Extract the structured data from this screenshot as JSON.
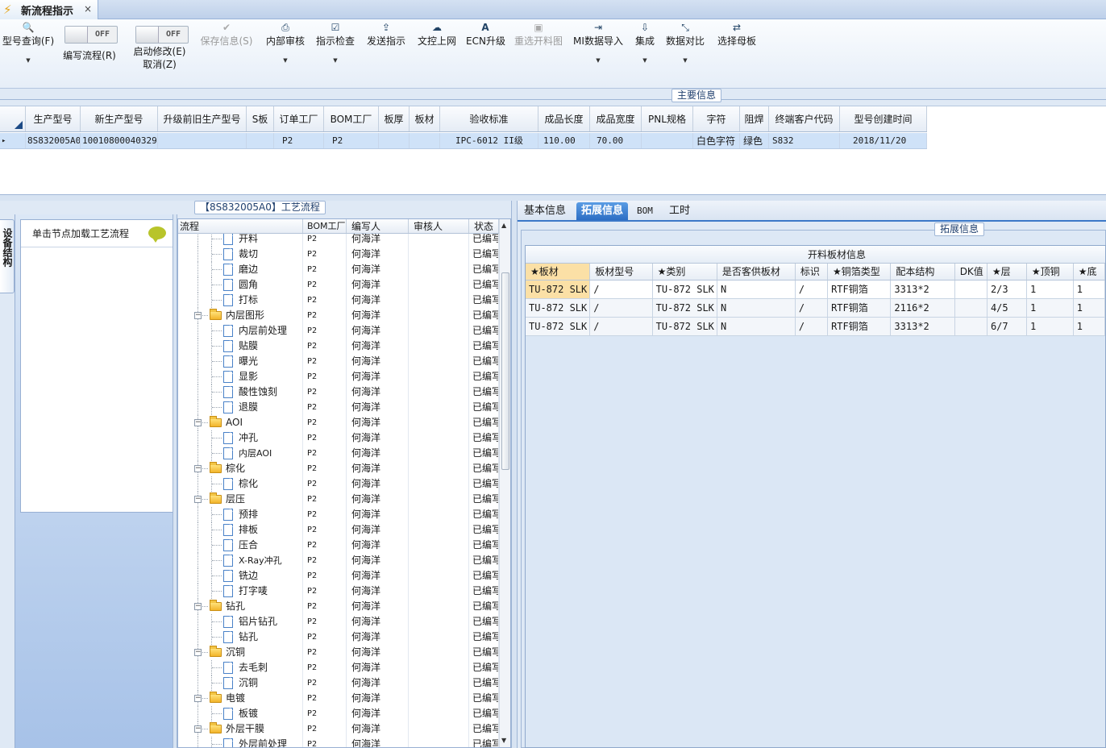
{
  "window": {
    "tab_title": "新流程指示",
    "close_glyph": "×",
    "tab_icon": "lightning-icon"
  },
  "toolbar": {
    "buttons": [
      {
        "label": "型号查询(F)",
        "icon": "search-icon",
        "glyph": "🔍",
        "enabled": true
      },
      {
        "label": "编写流程(R)",
        "toggle": "OFF"
      },
      {
        "label": "启动修改(E)",
        "label2": "取消(Z)",
        "toggle": "OFF"
      },
      {
        "label": "保存信息(S)",
        "icon": "check-icon",
        "glyph": "✔",
        "enabled": false
      },
      {
        "label": "内部审核",
        "icon": "print-icon",
        "glyph": "⎙",
        "enabled": true
      },
      {
        "label": "指示检查",
        "icon": "checkbox-icon",
        "glyph": "☑",
        "enabled": true
      },
      {
        "label": "发送指示",
        "icon": "upload-icon",
        "glyph": "⇪",
        "enabled": true
      },
      {
        "label": "文控上网",
        "icon": "cloud-upload-icon",
        "glyph": "☁",
        "enabled": true
      },
      {
        "label": "ECN升级",
        "icon": "font-a-icon",
        "glyph": "A",
        "enabled": true
      },
      {
        "label": "重选开料图",
        "icon": "image-icon",
        "glyph": "▣",
        "enabled": false
      },
      {
        "label": "MI数据导入",
        "icon": "sign-in-icon",
        "glyph": "⇥",
        "enabled": true
      },
      {
        "label": "集成",
        "icon": "download-icon",
        "glyph": "⇩",
        "enabled": true
      },
      {
        "label": "数据对比",
        "icon": "compress-icon",
        "glyph": "⤡",
        "enabled": true
      },
      {
        "label": "选择母板",
        "icon": "shuffle-icon",
        "glyph": "⇄",
        "enabled": true
      }
    ],
    "dropdown_glyph": "▼"
  },
  "main_info": {
    "caption": "主要信息",
    "columns": [
      "生产型号",
      "新生产型号",
      "升级前旧生产型号",
      "S板",
      "订单工厂",
      "BOM工厂",
      "板厚",
      "板材",
      "验收标准",
      "成品长度",
      "成品宽度",
      "PNL规格",
      "字符",
      "阻焊",
      "终端客户代码",
      "型号创建时间"
    ],
    "row": [
      "8S832005A0",
      "10010800040329",
      "",
      "",
      "P2",
      "P2",
      "",
      "",
      "IPC-6012 II级",
      "110.00",
      "70.00",
      "",
      "白色字符",
      "绿色",
      "S832",
      "2018/11/20"
    ],
    "row_indicator": "▸"
  },
  "left_panel": {
    "vertical_tab": "设备结构",
    "hint": "单击节点加载工艺流程"
  },
  "process_tree": {
    "caption": "【8S832005A0】工艺流程",
    "columns": [
      "流程",
      "BOM工厂",
      "编写人",
      "审核人",
      "状态"
    ],
    "rows": [
      {
        "name": "开料",
        "level": 2,
        "type": "doc",
        "factory": "P2",
        "author": "何海洋",
        "status": "已编写"
      },
      {
        "name": "裁切",
        "level": 2,
        "type": "doc",
        "factory": "P2",
        "author": "何海洋",
        "status": "已编写"
      },
      {
        "name": "磨边",
        "level": 2,
        "type": "doc",
        "factory": "P2",
        "author": "何海洋",
        "status": "已编写"
      },
      {
        "name": "圆角",
        "level": 2,
        "type": "doc",
        "factory": "P2",
        "author": "何海洋",
        "status": "已编写"
      },
      {
        "name": "打标",
        "level": 2,
        "type": "doc",
        "factory": "P2",
        "author": "何海洋",
        "status": "已编写"
      },
      {
        "name": "内层图形",
        "level": 1,
        "type": "folder",
        "factory": "P2",
        "author": "何海洋",
        "status": "已编写"
      },
      {
        "name": "内层前处理",
        "level": 2,
        "type": "doc",
        "factory": "P2",
        "author": "何海洋",
        "status": "已编写"
      },
      {
        "name": "贴膜",
        "level": 2,
        "type": "doc",
        "factory": "P2",
        "author": "何海洋",
        "status": "已编写"
      },
      {
        "name": "曝光",
        "level": 2,
        "type": "doc",
        "factory": "P2",
        "author": "何海洋",
        "status": "已编写"
      },
      {
        "name": "显影",
        "level": 2,
        "type": "doc",
        "factory": "P2",
        "author": "何海洋",
        "status": "已编写"
      },
      {
        "name": "酸性蚀刻",
        "level": 2,
        "type": "doc",
        "factory": "P2",
        "author": "何海洋",
        "status": "已编写"
      },
      {
        "name": "退膜",
        "level": 2,
        "type": "doc",
        "factory": "P2",
        "author": "何海洋",
        "status": "已编写"
      },
      {
        "name": "AOI",
        "level": 1,
        "type": "folder",
        "factory": "P2",
        "author": "何海洋",
        "status": "已编写"
      },
      {
        "name": "冲孔",
        "level": 2,
        "type": "doc",
        "factory": "P2",
        "author": "何海洋",
        "status": "已编写"
      },
      {
        "name": "内层AOI",
        "level": 2,
        "type": "doc",
        "factory": "P2",
        "author": "何海洋",
        "status": "已编写"
      },
      {
        "name": "棕化",
        "level": 1,
        "type": "folder",
        "factory": "P2",
        "author": "何海洋",
        "status": "已编写"
      },
      {
        "name": "棕化",
        "level": 2,
        "type": "doc",
        "factory": "P2",
        "author": "何海洋",
        "status": "已编写"
      },
      {
        "name": "层压",
        "level": 1,
        "type": "folder",
        "factory": "P2",
        "author": "何海洋",
        "status": "已编写"
      },
      {
        "name": "预排",
        "level": 2,
        "type": "doc",
        "factory": "P2",
        "author": "何海洋",
        "status": "已编写"
      },
      {
        "name": "排板",
        "level": 2,
        "type": "doc",
        "factory": "P2",
        "author": "何海洋",
        "status": "已编写"
      },
      {
        "name": "压合",
        "level": 2,
        "type": "doc",
        "factory": "P2",
        "author": "何海洋",
        "status": "已编写"
      },
      {
        "name": "X-Ray冲孔",
        "level": 2,
        "type": "doc",
        "factory": "P2",
        "author": "何海洋",
        "status": "已编写"
      },
      {
        "name": "铣边",
        "level": 2,
        "type": "doc",
        "factory": "P2",
        "author": "何海洋",
        "status": "已编写"
      },
      {
        "name": "打字唛",
        "level": 2,
        "type": "doc",
        "factory": "P2",
        "author": "何海洋",
        "status": "已编写"
      },
      {
        "name": "钻孔",
        "level": 1,
        "type": "folder",
        "factory": "P2",
        "author": "何海洋",
        "status": "已编写"
      },
      {
        "name": "铝片钻孔",
        "level": 2,
        "type": "doc",
        "factory": "P2",
        "author": "何海洋",
        "status": "已编写"
      },
      {
        "name": "钻孔",
        "level": 2,
        "type": "doc",
        "factory": "P2",
        "author": "何海洋",
        "status": "已编写"
      },
      {
        "name": "沉铜",
        "level": 1,
        "type": "folder",
        "factory": "P2",
        "author": "何海洋",
        "status": "已编写"
      },
      {
        "name": "去毛刺",
        "level": 2,
        "type": "doc",
        "factory": "P2",
        "author": "何海洋",
        "status": "已编写"
      },
      {
        "name": "沉铜",
        "level": 2,
        "type": "doc",
        "factory": "P2",
        "author": "何海洋",
        "status": "已编写"
      },
      {
        "name": "电镀",
        "level": 1,
        "type": "folder",
        "factory": "P2",
        "author": "何海洋",
        "status": "已编写"
      },
      {
        "name": "板镀",
        "level": 2,
        "type": "doc",
        "factory": "P2",
        "author": "何海洋",
        "status": "已编写"
      },
      {
        "name": "外层干膜",
        "level": 1,
        "type": "folder",
        "factory": "P2",
        "author": "何海洋",
        "status": "已编写"
      },
      {
        "name": "外层前处理",
        "level": 2,
        "type": "doc",
        "factory": "P2",
        "author": "何海洋",
        "status": "已编写"
      }
    ]
  },
  "right_tabs": {
    "tabs": [
      "基本信息",
      "拓展信息",
      "BOM",
      "工时"
    ],
    "active": 1,
    "caption": "拓展信息"
  },
  "plate_table": {
    "title": "开料板材信息",
    "columns": [
      "★板材",
      "板材型号",
      "★类别",
      "是否客供板材",
      "标识",
      "★铜箔类型",
      "配本结构",
      "DK值",
      "★层",
      "★顶铜",
      "★底"
    ],
    "rows": [
      [
        "TU-872 SLK",
        "/",
        "TU-872 SLK",
        "N",
        "/",
        "RTF铜箔",
        "3313*2",
        "",
        "2/3",
        "1",
        "1"
      ],
      [
        "TU-872 SLK",
        "/",
        "TU-872 SLK",
        "N",
        "/",
        "RTF铜箔",
        "2116*2",
        "",
        "4/5",
        "1",
        "1"
      ],
      [
        "TU-872 SLK",
        "/",
        "TU-872 SLK",
        "N",
        "/",
        "RTF铜箔",
        "3313*2",
        "",
        "6/7",
        "1",
        "1"
      ]
    ]
  }
}
